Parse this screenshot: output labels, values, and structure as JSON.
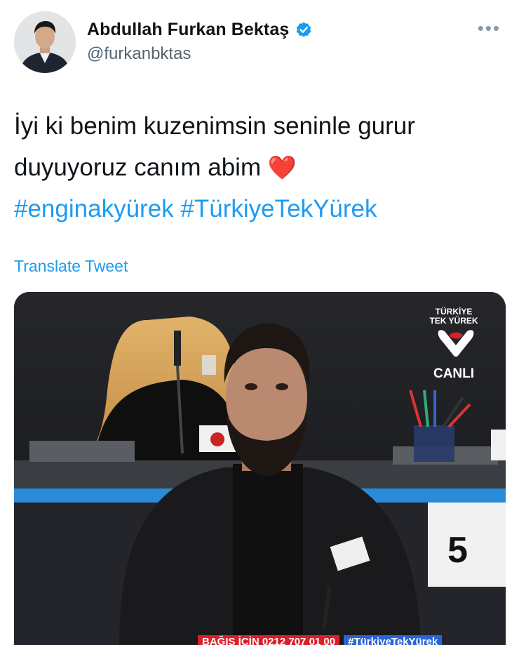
{
  "author": {
    "display_name": "Abdullah Furkan Bektaş",
    "handle": "@furkanbktas",
    "verified_icon": "verified-badge-icon",
    "avatar_icon": "profile-avatar"
  },
  "more_label": "•••",
  "tweet": {
    "line1": "İyi ki benim kuzenimsin seninle gurur",
    "line2": "duyuyoruz canım abim",
    "heart": "❤️",
    "hashtag1": "#enginakyürek",
    "hashtag2": "#TürkiyeTekYürek"
  },
  "translate_label": "Translate Tweet",
  "media": {
    "brand_line1": "TÜRKİYE",
    "brand_line2": "TEK YÜREK",
    "live_label": "CANLI",
    "desk_number": "5",
    "ticker_phone": "BAĞIŞ İÇİN 0212 707 01 00",
    "ticker_hashtag": "#TürkiyeTekYürek"
  },
  "colors": {
    "link": "#1d9bf0",
    "secondary_text": "#536471",
    "verified": "#1d9bf0",
    "heart": "#e0245e",
    "brand_red": "#d9202a"
  }
}
